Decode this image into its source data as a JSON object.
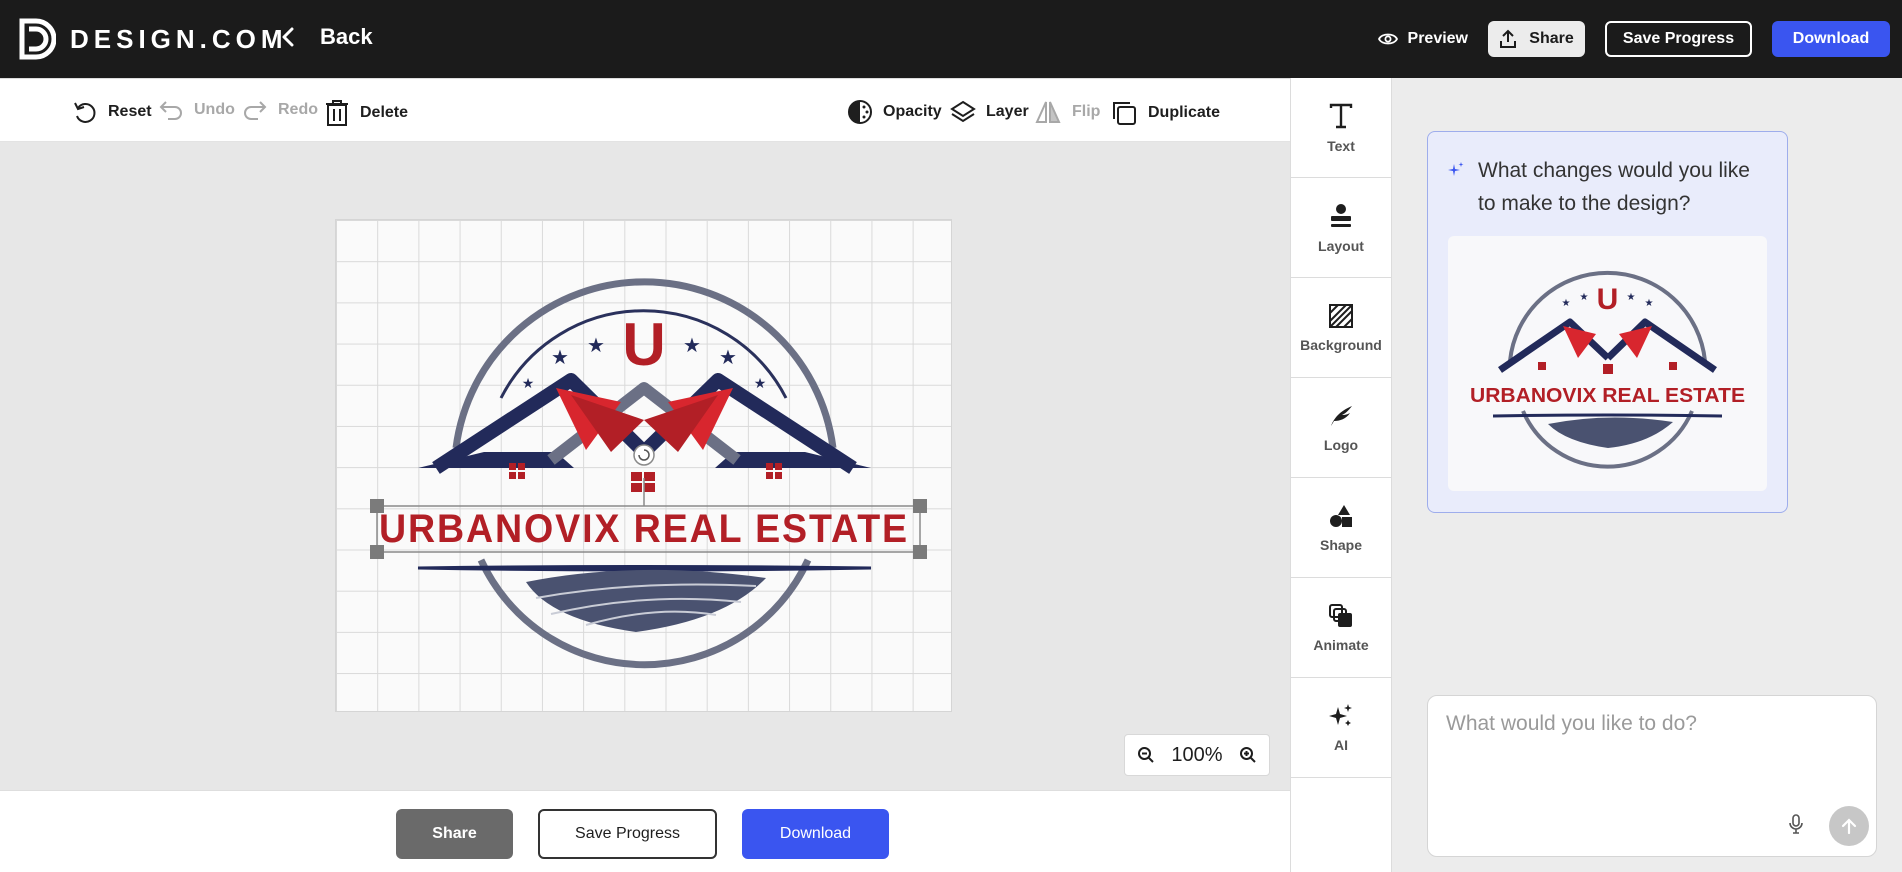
{
  "header": {
    "brand": "DESIGN.COM",
    "back_label": "Back",
    "preview_label": "Preview",
    "share_label": "Share",
    "save_label": "Save Progress",
    "download_label": "Download"
  },
  "toolbar": {
    "reset": "Reset",
    "undo": "Undo",
    "redo": "Redo",
    "delete": "Delete",
    "opacity": "Opacity",
    "layer": "Layer",
    "flip": "Flip",
    "duplicate": "Duplicate"
  },
  "canvas": {
    "logo_letter": "U",
    "logo_text": "URBANOVIX REAL ESTATE",
    "zoom_level": "100%"
  },
  "bottom": {
    "share_label": "Share",
    "save_label": "Save Progress",
    "download_label": "Download"
  },
  "sidepanel": {
    "items": [
      {
        "label": "Text",
        "icon": "text-icon"
      },
      {
        "label": "Layout",
        "icon": "layout-icon"
      },
      {
        "label": "Background",
        "icon": "background-icon"
      },
      {
        "label": "Logo",
        "icon": "logo-icon"
      },
      {
        "label": "Shape",
        "icon": "shape-icon"
      },
      {
        "label": "Animate",
        "icon": "animate-icon"
      },
      {
        "label": "AI",
        "icon": "ai-sparkle-icon"
      }
    ]
  },
  "chat": {
    "prompt": "What changes would you like to make to the design?",
    "preview_letter": "U",
    "preview_text": "URBANOVIX REAL ESTATE",
    "input_placeholder": "What would you like to do?"
  },
  "colors": {
    "accent": "#3a55f0",
    "logo_red": "#b21f26",
    "logo_navy": "#222a5a",
    "logo_slate": "#4a5270"
  }
}
